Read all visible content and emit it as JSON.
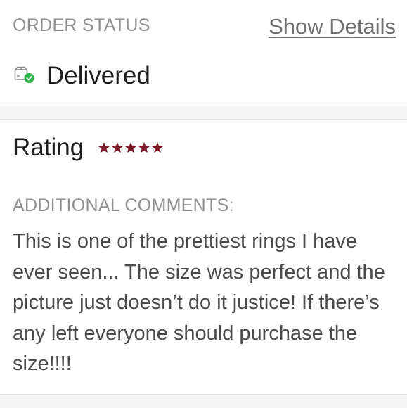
{
  "order": {
    "status_label": "ORDER STATUS",
    "show_details_label": "Show Details",
    "status_value": "Delivered",
    "status_icon": "box-delivered-icon"
  },
  "review": {
    "rating_label": "Rating",
    "rating_stars": 5,
    "rating_max": 5,
    "comments_label": "ADDITIONAL COMMENTS:",
    "comment_text": "This is one of the prettiest rings I have ever seen... The size was perfect and the picture just doesn’t do it justice! If there’s any left everyone should purchase the size!!!!"
  },
  "colors": {
    "star": "#7a1c2a",
    "check": "#2eb34a",
    "muted_label": "#8f8f8f"
  }
}
